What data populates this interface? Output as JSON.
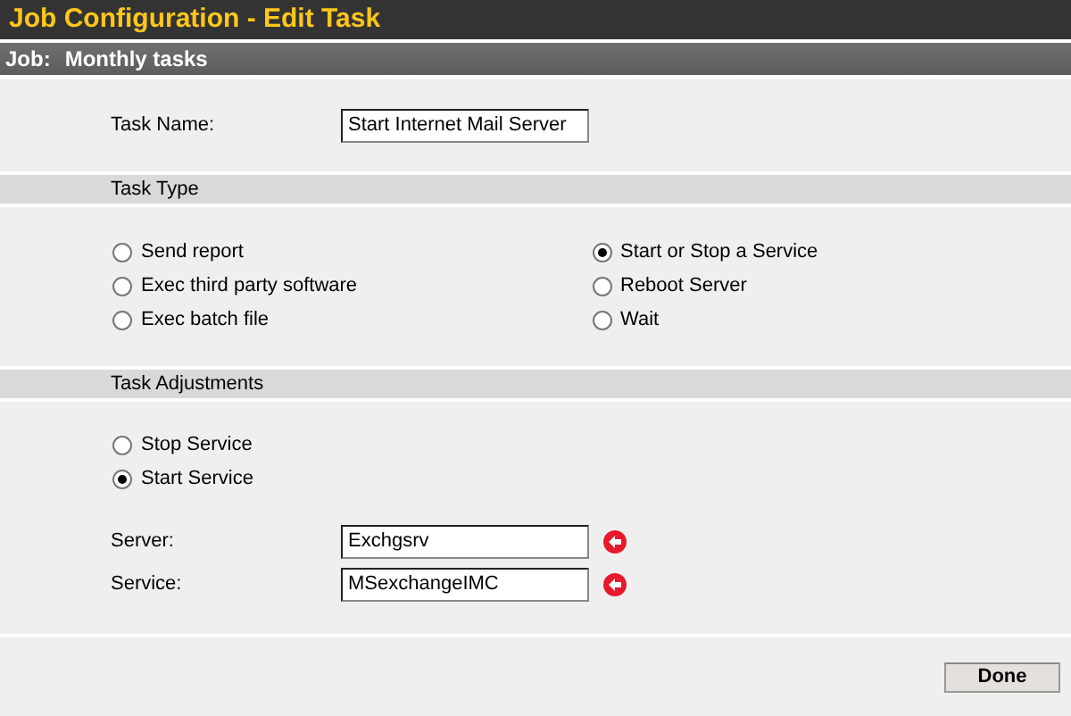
{
  "title": "Job Configuration - Edit Task",
  "job": {
    "label": "Job:",
    "value": "Monthly tasks"
  },
  "task_name": {
    "label": "Task Name:",
    "value": "Start Internet Mail Server"
  },
  "task_type": {
    "heading": "Task Type",
    "columns": [
      [
        {
          "label": "Send report",
          "selected": false
        },
        {
          "label": "Exec third party software",
          "selected": false
        },
        {
          "label": "Exec batch file",
          "selected": false
        }
      ],
      [
        {
          "label": "Start or Stop a Service",
          "selected": true
        },
        {
          "label": "Reboot Server",
          "selected": false
        },
        {
          "label": "Wait",
          "selected": false
        }
      ]
    ]
  },
  "task_adjustments": {
    "heading": "Task Adjustments",
    "options": [
      {
        "label": "Stop Service",
        "selected": false
      },
      {
        "label": "Start Service",
        "selected": true
      }
    ],
    "fields": [
      {
        "label": "Server:",
        "value": "Exchgsrv"
      },
      {
        "label": "Service:",
        "value": "MSexchangeIMC"
      }
    ]
  },
  "done_button": "Done"
}
